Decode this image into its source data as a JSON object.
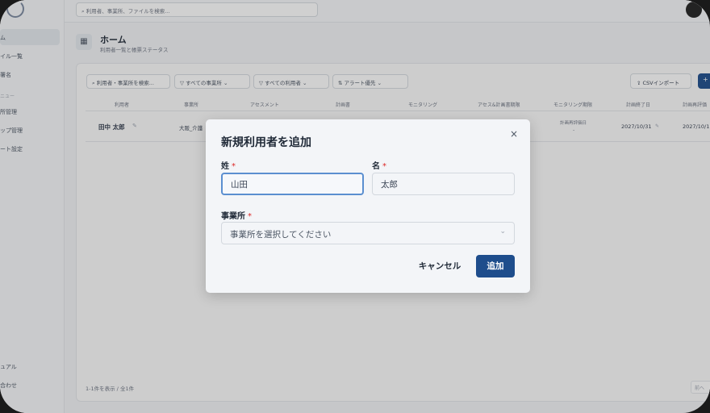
{
  "sidebar": {
    "items": [
      {
        "label": "ム"
      },
      {
        "label": "イル一覧"
      },
      {
        "label": "署名"
      },
      {
        "label": "ニュー"
      },
      {
        "label": "所管理"
      },
      {
        "label": "ップ管理"
      },
      {
        "label": "ート設定"
      },
      {
        "label": "ュアル"
      },
      {
        "label": "合わせ"
      }
    ]
  },
  "topbar": {
    "search_placeholder": "利用者、事業所、ファイルを検索..."
  },
  "page": {
    "title": "ホーム",
    "subtitle": "利用者一覧と帳票ステータス"
  },
  "filters": {
    "search": "利用者・事業所を検索...",
    "office": "すべての事業所",
    "user": "すべての利用者",
    "sort": "アラート優先",
    "csv_button": "CSVインポート",
    "add_button": "+"
  },
  "table": {
    "headers": [
      "利用者",
      "事業所",
      "アセスメント",
      "計画書",
      "モニタリング",
      "アセス&計画書期限",
      "モニタリング期限",
      "計画終了日",
      "計画再評価"
    ],
    "rows": [
      {
        "user": "田中 太郎",
        "office": "大阪_介護",
        "monitoring_deadline_label": "計画再評価日",
        "monitoring_deadline_value": "-",
        "plan_end": "2027/10/31",
        "plan_review": "2027/10/1"
      }
    ]
  },
  "footer": {
    "count": "1-1件を表示 / 全1件",
    "prev": "前へ"
  },
  "modal": {
    "title": "新規利用者を追加",
    "close": "×",
    "last_name_label": "姓",
    "last_name_value": "山田",
    "first_name_label": "名",
    "first_name_value": "太郎",
    "required_mark": "*",
    "office_label": "事業所",
    "office_placeholder": "事業所を選択してください",
    "cancel": "キャンセル",
    "submit": "追加"
  },
  "colors": {
    "primary": "#1e4d8c",
    "required": "#dc2626",
    "focus": "#5b8fd0"
  }
}
